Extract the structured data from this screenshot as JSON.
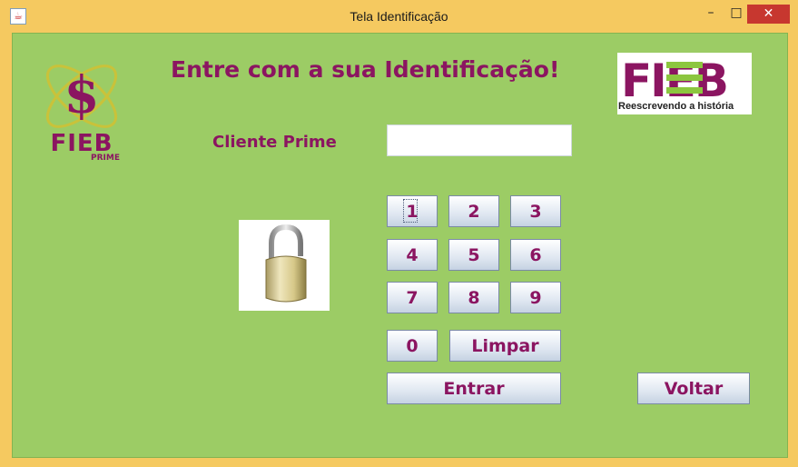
{
  "window": {
    "title": "Tela Identificação",
    "minimize_glyph": "–",
    "maximize_glyph": "□",
    "close_glyph": "✕"
  },
  "header": {
    "heading": "Entre com a sua Identificação!"
  },
  "form": {
    "client_label": "Cliente Prime",
    "client_value": ""
  },
  "keypad": {
    "keys": [
      "1",
      "2",
      "3",
      "4",
      "5",
      "6",
      "7",
      "8",
      "9",
      "0"
    ],
    "clear_label": "Limpar",
    "enter_label": "Entrar",
    "back_label": "Voltar"
  },
  "logos": {
    "left_text": "FIEB",
    "left_sub": "PRIME",
    "right_text": "FIEB",
    "right_caption": "Reescrevendo a história"
  },
  "colors": {
    "background": "#9ccc65",
    "accent": "#8b1561",
    "titlebar": "#f5c960"
  }
}
